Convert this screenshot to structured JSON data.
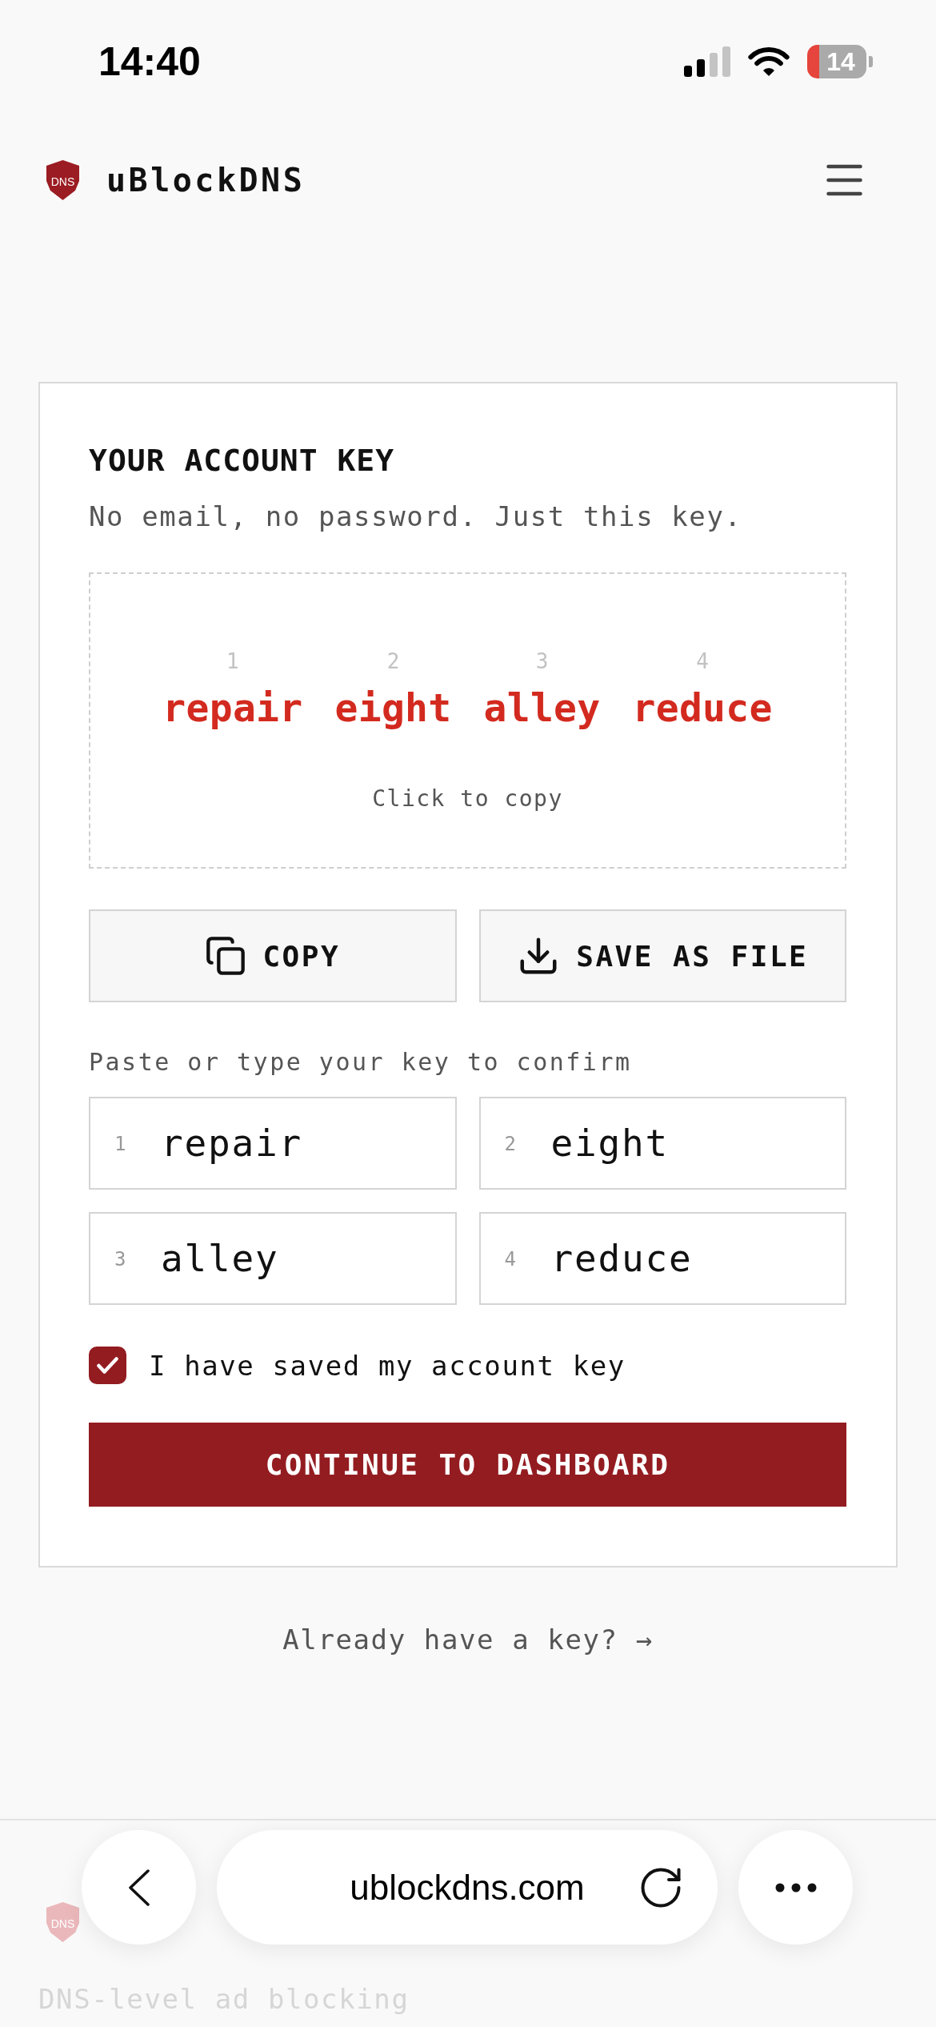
{
  "status_bar": {
    "time": "14:40",
    "battery": "14"
  },
  "header": {
    "logo_text": "DNS",
    "brand": "uBlockDNS"
  },
  "account_key": {
    "title": "YOUR ACCOUNT KEY",
    "subtitle": "No email, no password. Just this key.",
    "key_words": [
      {
        "number": "1",
        "word": "repair"
      },
      {
        "number": "2",
        "word": "eight"
      },
      {
        "number": "3",
        "word": "alley"
      },
      {
        "number": "4",
        "word": "reduce"
      }
    ],
    "copy_hint": "Click to copy",
    "actions": [
      {
        "kind": "copy",
        "label": "COPY"
      },
      {
        "kind": "download",
        "label": "SAVE AS FILE"
      }
    ],
    "confirm_label": "Paste or type your key to confirm",
    "confirm_fields": [
      {
        "number": "1",
        "value": "repair"
      },
      {
        "number": "2",
        "value": "eight"
      },
      {
        "number": "3",
        "value": "alley"
      },
      {
        "number": "4",
        "value": "reduce"
      }
    ],
    "saved_checkbox": {
      "label": "I have saved my account key",
      "checked": true
    },
    "continue_button": "CONTINUE TO DASHBOARD"
  },
  "existing_key_link": "Already have a key? →",
  "footer": {
    "logo_text": "DNS",
    "tagline": "DNS-level ad blocking"
  },
  "browser_bar": {
    "url": "ublockdns.com"
  }
}
